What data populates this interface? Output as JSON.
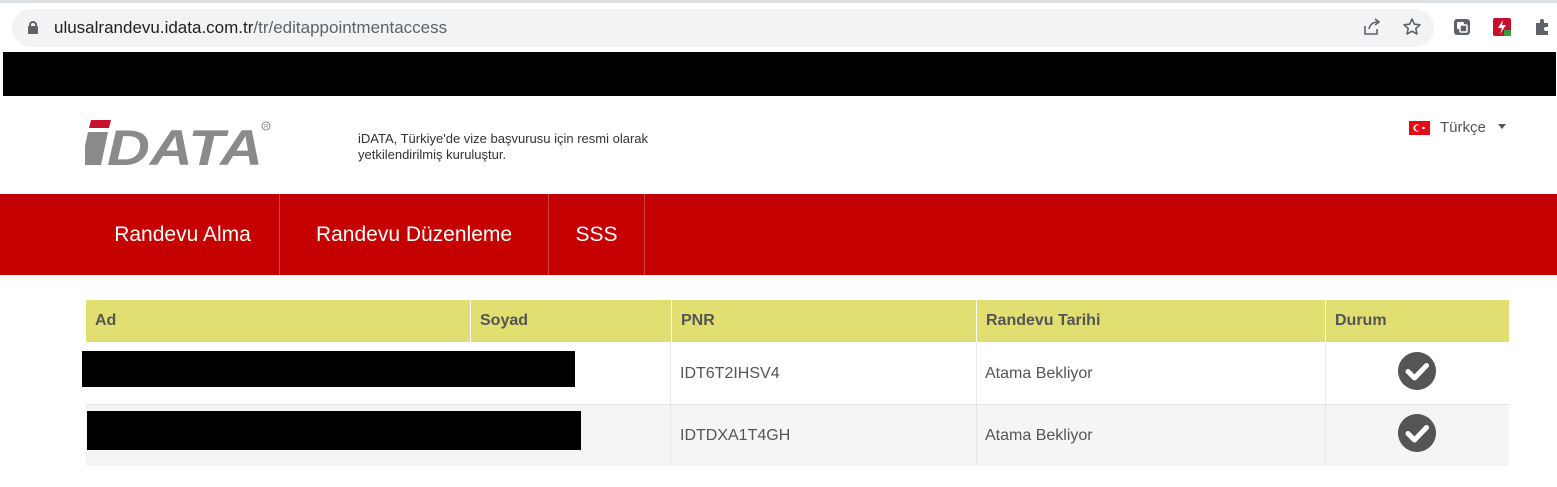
{
  "browser": {
    "url_host": "ulusalrandevu.idata.com.tr",
    "url_path": "/tr/editappointmentaccess",
    "icons": [
      "lock-icon",
      "share-icon",
      "bookmark-star-icon",
      "extension-icon",
      "flash-extension-icon",
      "puzzle-icon"
    ]
  },
  "header": {
    "logo_text": "iDATA",
    "tagline": "iDATA, Türkiye'de vize başvurusu için resmi olarak yetkilendirilmiş kuruluştur.",
    "language": "Türkçe"
  },
  "nav": {
    "items": [
      {
        "label": "Randevu Alma"
      },
      {
        "label": "Randevu Düzenleme"
      },
      {
        "label": "SSS"
      }
    ]
  },
  "table": {
    "columns": [
      "Ad",
      "Soyad",
      "PNR",
      "Randevu Tarihi",
      "Durum"
    ],
    "rows": [
      {
        "pnr": "IDT6T2IHSV4",
        "date": "Atama Bekliyor",
        "status_icon": "check-circle-icon"
      },
      {
        "pnr": "IDTDXA1T4GH",
        "date": "Atama Bekliyor",
        "status_icon": "check-circle-icon"
      }
    ]
  },
  "colors": {
    "nav_bg": "#c40000",
    "table_header_bg": "#e1de72",
    "logo_red": "#c8102e",
    "logo_gray": "#8a8a8a"
  }
}
